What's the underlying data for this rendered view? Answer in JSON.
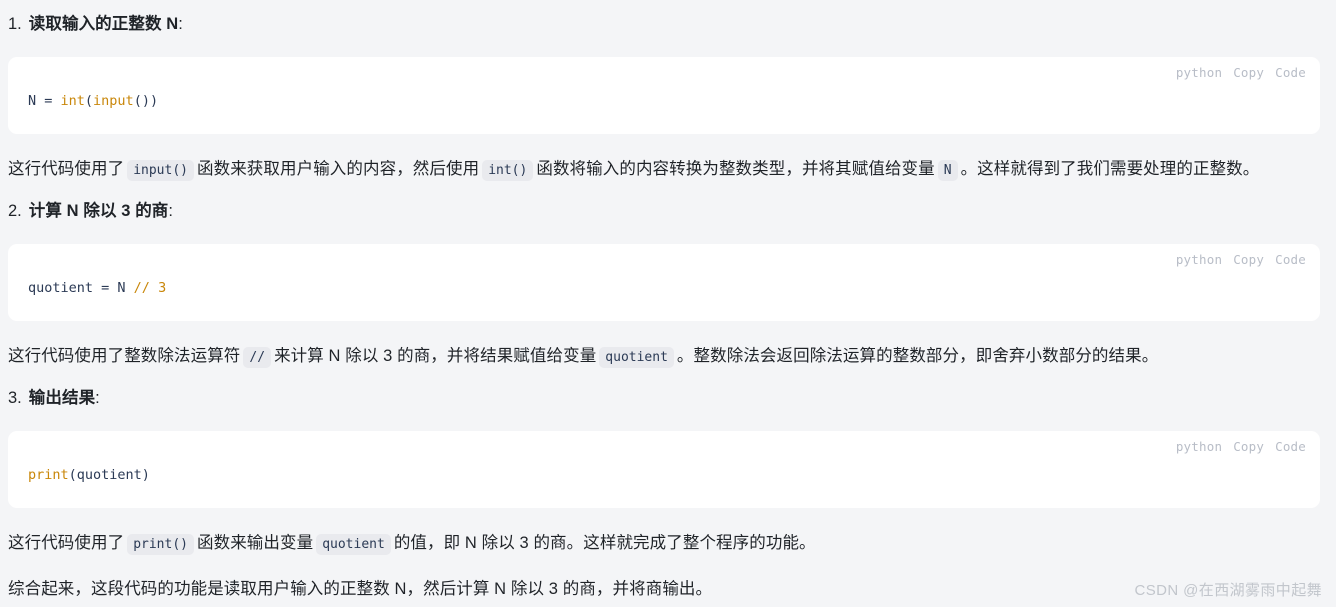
{
  "background_color": "#f4f5f7",
  "steps": [
    {
      "marker": "1.",
      "title": "读取输入的正整数 N",
      "colon": ":",
      "code": {
        "lang_label": "python",
        "copy_label": "Copy",
        "code_label": "Code",
        "lines": [
          [
            {
              "t": "N = ",
              "c": "plain"
            },
            {
              "t": "int",
              "c": "fn"
            },
            {
              "t": "(",
              "c": "plain"
            },
            {
              "t": "input",
              "c": "fn"
            },
            {
              "t": "())",
              "c": "plain"
            }
          ]
        ],
        "plain_text": "N = int(input())"
      },
      "explanation": [
        {
          "t": "这行代码使用了 ",
          "c": "text"
        },
        {
          "t": "input()",
          "c": "code"
        },
        {
          "t": " 函数来获取用户输入的内容，然后使用 ",
          "c": "text"
        },
        {
          "t": "int()",
          "c": "code"
        },
        {
          "t": " 函数将输入的内容转换为整数类型，并将其赋值给变量 ",
          "c": "text"
        },
        {
          "t": "N",
          "c": "code"
        },
        {
          "t": " 。这样就得到了我们需要处理的正整数。",
          "c": "text"
        }
      ]
    },
    {
      "marker": "2.",
      "title": "计算 N 除以 3 的商",
      "colon": ":",
      "code": {
        "lang_label": "python",
        "copy_label": "Copy",
        "code_label": "Code",
        "lines": [
          [
            {
              "t": "quotient = N ",
              "c": "plain"
            },
            {
              "t": "//",
              "c": "op"
            },
            {
              "t": " ",
              "c": "plain"
            },
            {
              "t": "3",
              "c": "num"
            }
          ]
        ],
        "plain_text": "quotient = N // 3"
      },
      "explanation": [
        {
          "t": "这行代码使用了整数除法运算符 ",
          "c": "text"
        },
        {
          "t": "//",
          "c": "code"
        },
        {
          "t": " 来计算 N 除以 3 的商，并将结果赋值给变量 ",
          "c": "text"
        },
        {
          "t": "quotient",
          "c": "code"
        },
        {
          "t": " 。整数除法会返回除法运算的整数部分，即舍弃小数部分的结果。",
          "c": "text"
        }
      ]
    },
    {
      "marker": "3.",
      "title": "输出结果",
      "colon": ":",
      "code": {
        "lang_label": "python",
        "copy_label": "Copy",
        "code_label": "Code",
        "lines": [
          [
            {
              "t": "print",
              "c": "fn"
            },
            {
              "t": "(quotient)",
              "c": "plain"
            }
          ]
        ],
        "plain_text": "print(quotient)"
      },
      "explanation": [
        {
          "t": "这行代码使用了 ",
          "c": "text"
        },
        {
          "t": "print()",
          "c": "code"
        },
        {
          "t": " 函数来输出变量 ",
          "c": "text"
        },
        {
          "t": "quotient",
          "c": "code"
        },
        {
          "t": " 的值，即 N 除以 3 的商。这样就完成了整个程序的功能。",
          "c": "text"
        }
      ]
    }
  ],
  "summary": "综合起来，这段代码的功能是读取用户输入的正整数 N，然后计算 N 除以 3 的商，并将商输出。",
  "watermark": "CSDN @在西湖雾雨中起舞"
}
